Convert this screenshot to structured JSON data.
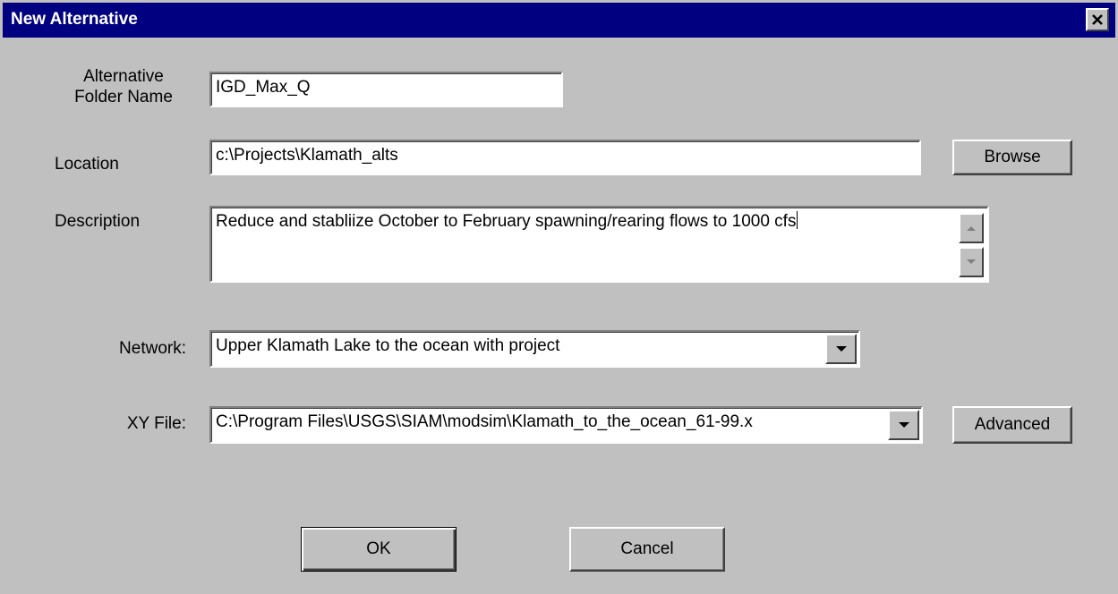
{
  "window": {
    "title": "New Alternative"
  },
  "form": {
    "folder_name_label": "Alternative Folder Name",
    "folder_name_value": "IGD_Max_Q",
    "location_label": "Location",
    "location_value": "c:\\Projects\\Klamath_alts",
    "browse_label": "Browse",
    "description_label": "Description",
    "description_value": "Reduce and stabliize October to February spawning/rearing flows to 1000 cfs",
    "network_label": "Network:",
    "network_value": "Upper Klamath Lake to the ocean with project",
    "xy_label": "XY File:",
    "xy_value": "C:\\Program Files\\USGS\\SIAM\\modsim\\Klamath_to_the_ocean_61-99.x",
    "advanced_label": "Advanced"
  },
  "buttons": {
    "ok_label": "OK",
    "cancel_label": "Cancel"
  },
  "icons": {
    "close": "close-icon",
    "dropdown": "chevron-down-icon",
    "scroll_up": "arrow-up-icon",
    "scroll_down": "arrow-down-icon"
  },
  "colors": {
    "titlebar": "#000080",
    "face": "#c0c0c0"
  }
}
